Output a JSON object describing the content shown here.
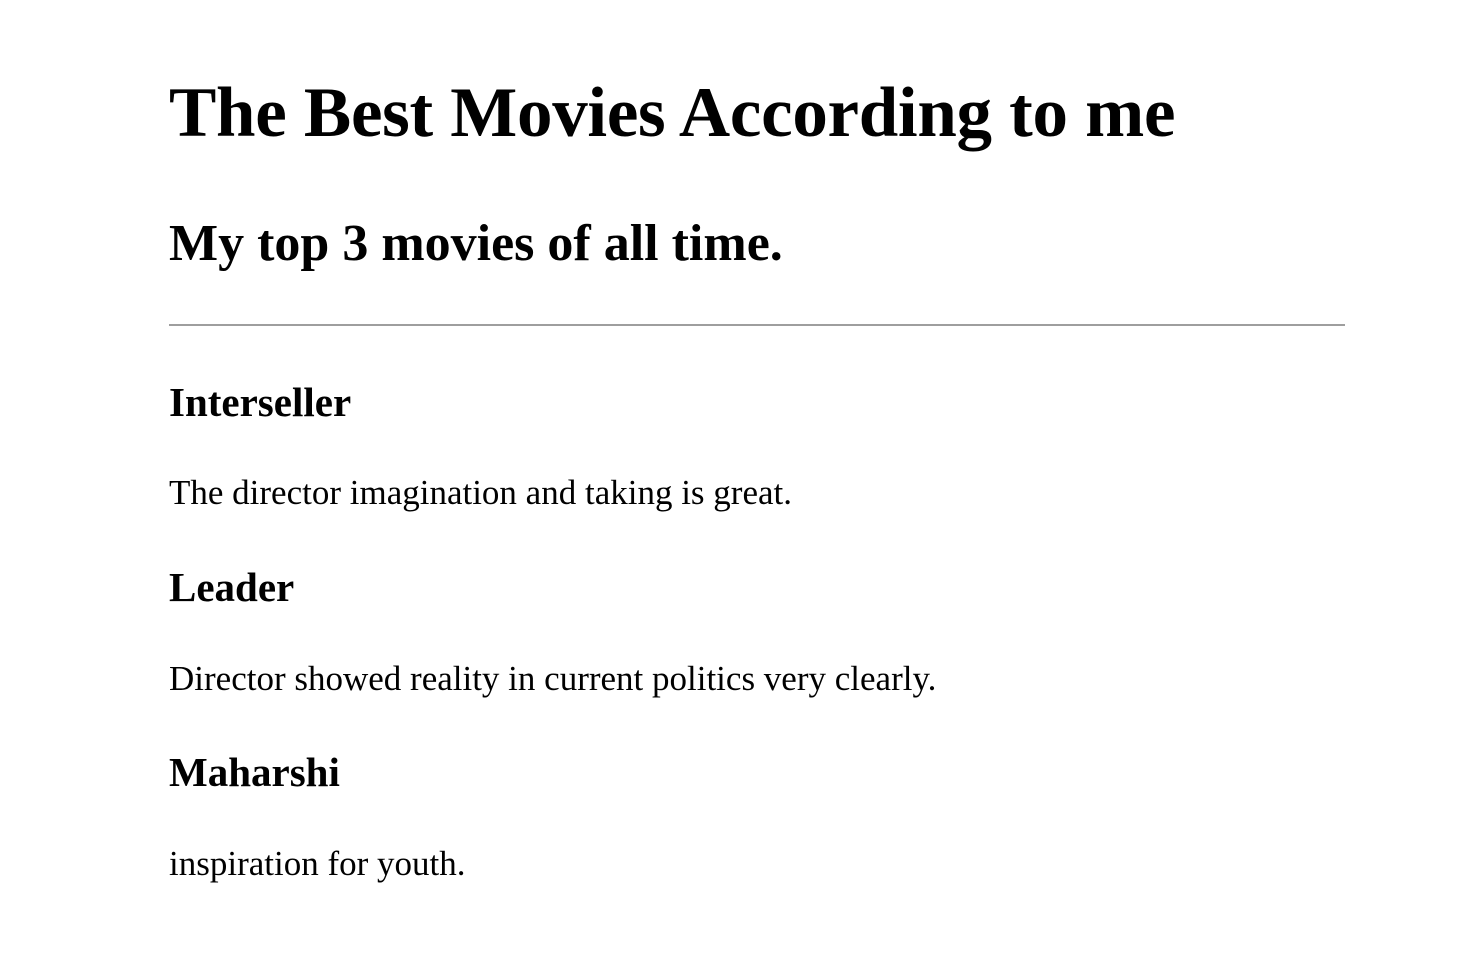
{
  "page": {
    "title": "The Best Movies According to me",
    "subtitle": "My top 3 movies of all time."
  },
  "movies": [
    {
      "name": "Interseller",
      "description": "The director imagination and taking is great."
    },
    {
      "name": "Leader",
      "description": "Director showed reality in current politics very clearly."
    },
    {
      "name": "Maharshi",
      "description": "inspiration for youth."
    }
  ],
  "colors": {
    "background": "#ffffff",
    "text": "#000000",
    "divider": "#9e9e9e"
  }
}
